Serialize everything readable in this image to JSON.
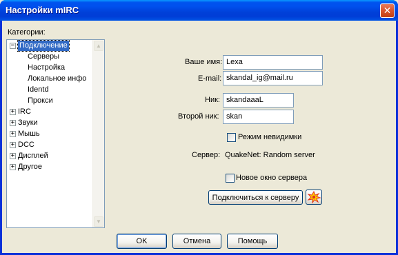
{
  "window": {
    "title": "Настройки mIRC",
    "close_glyph": "✕"
  },
  "categories_label": "Категории:",
  "tree": {
    "nodes": [
      {
        "label": "Подключение",
        "expander": "−",
        "selected": true
      },
      {
        "label": "Серверы"
      },
      {
        "label": "Настройка"
      },
      {
        "label": "Локальное инфо"
      },
      {
        "label": "Identd"
      },
      {
        "label": "Прокси"
      },
      {
        "label": "IRC",
        "expander": "+"
      },
      {
        "label": "Звуки",
        "expander": "+"
      },
      {
        "label": "Мышь",
        "expander": "+"
      },
      {
        "label": "DCC",
        "expander": "+"
      },
      {
        "label": "Дисплей",
        "expander": "+"
      },
      {
        "label": "Другое",
        "expander": "+"
      }
    ],
    "scroll_up": "▲",
    "scroll_down": "▼"
  },
  "form": {
    "name_label": "Ваше имя:",
    "name_value": "Lexa",
    "email_label": "E-mail:",
    "email_value": "skandal_ig@mail.ru",
    "nick_label": "Ник:",
    "nick_value": "skandaaaL",
    "alt_nick_label": "Второй ник:",
    "alt_nick_value": "skan",
    "invisible_label": "Режим невидимки",
    "invisible_checked": false,
    "server_label": "Сервер:",
    "server_value": "QuakeNet: Random server",
    "new_window_label": "Новое окно сервера",
    "new_window_checked": false,
    "connect_label": "Подключиться к серверу",
    "connect_icon": "star-burst-icon"
  },
  "buttons": {
    "ok": "OK",
    "cancel": "Отмена",
    "help": "Помощь"
  },
  "colors": {
    "title_bar": "#0050ee",
    "selection": "#316ac5",
    "face": "#ece9d8"
  }
}
